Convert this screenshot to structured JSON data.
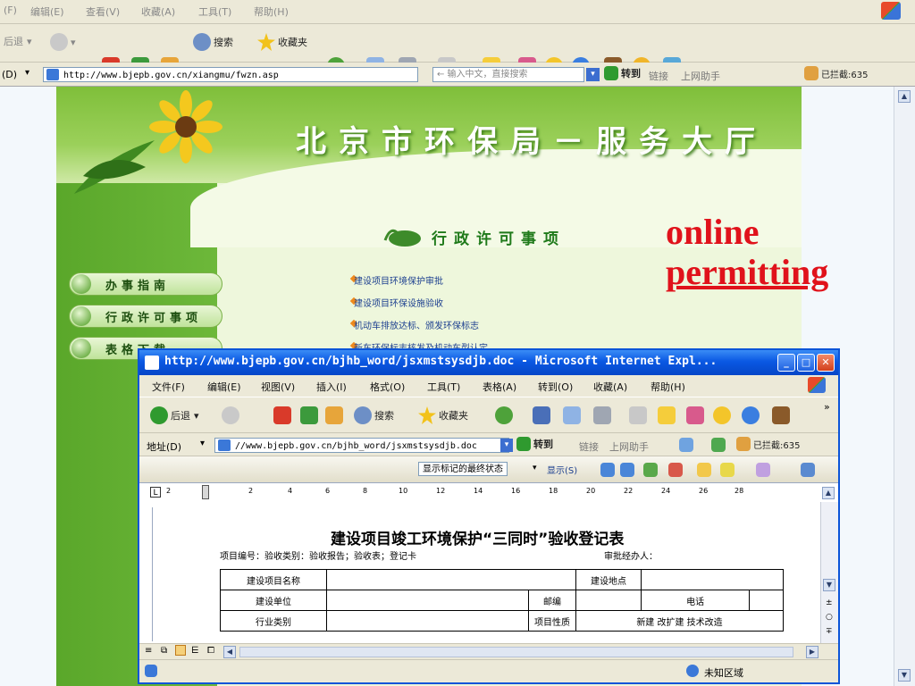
{
  "outer_browser": {
    "menu": [
      "(F)",
      "编辑(E)",
      "查看(V)",
      "收藏(A)",
      "工具(T)",
      "帮助(H)"
    ],
    "toolbar": {
      "back": "后退",
      "search": "搜索",
      "favorites": "收藏夹"
    },
    "address_label": "(D)",
    "address_url": "http://www.bjepb.gov.cn/xiangmu/fwzn.asp",
    "search_placeholder": "← 输入中文，直接搜索",
    "go_label": "转到",
    "links_label": "链接",
    "assistant_label": "上网助手",
    "blocked_label": "已拦截:635"
  },
  "site": {
    "title": "北京市环保局－服务大厅",
    "section_title": "行政许可事项",
    "sidebar": [
      {
        "label": "办事指南"
      },
      {
        "label": "行政许可事项"
      },
      {
        "label": "表格下载"
      }
    ],
    "links": [
      "建设项目环境保护审批",
      "建设项目环保设施验收",
      "机动车排放达标、颁发环保标志",
      "新车环保标志核发及机动车型认定"
    ]
  },
  "annotation": {
    "line1": "online",
    "line2": "permitting"
  },
  "popup": {
    "title": "http://www.bjepb.gov.cn/bjhb_word/jsxmstsysdjb.doc - Microsoft Internet Expl...",
    "menu": [
      "文件(F)",
      "编辑(E)",
      "视图(V)",
      "插入(I)",
      "格式(O)",
      "工具(T)",
      "表格(A)",
      "转到(O)",
      "收藏(A)",
      "帮助(H)"
    ],
    "toolbar": {
      "back": "后退",
      "search": "搜索",
      "favorites": "收藏夹"
    },
    "address_label": "地址(D)",
    "address_url": "//www.bjepb.gov.cn/bjhb_word/jsxmstsysdjb.doc",
    "go_label": "转到",
    "links_label": "链接",
    "assistant_label": "上网助手",
    "blocked_label": "已拦截:635",
    "review_state": "显示标记的最终状态",
    "show_label": "显示(S)",
    "ruler_ticks": [
      "2",
      "2",
      "4",
      "6",
      "8",
      "10",
      "12",
      "14",
      "16",
      "18",
      "20",
      "22",
      "24",
      "26",
      "28"
    ],
    "document": {
      "title": "建设项目竣工环境保护“三同时”验收登记表",
      "subtitle": "项目编号：验收类别：验收报告；验收表；登记卡",
      "approver": "审批经办人：",
      "rows": [
        [
          "建设项目名称",
          "",
          "建设地点",
          ""
        ],
        [
          "建设单位",
          "",
          "邮编",
          "",
          "电话",
          ""
        ],
        [
          "行业类别",
          "",
          "项目性质",
          "新建    改扩建  技术改造"
        ]
      ]
    },
    "status_zone": "未知区域"
  }
}
